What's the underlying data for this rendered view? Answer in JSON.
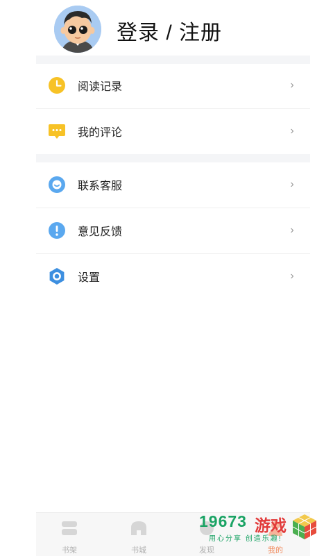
{
  "header": {
    "login_label": "登录 / 注册"
  },
  "menu_group_1": [
    {
      "label": "阅读记录",
      "icon": "clock-icon",
      "color": "#f7c226"
    },
    {
      "label": "我的评论",
      "icon": "comment-icon",
      "color": "#f7c226"
    }
  ],
  "menu_group_2": [
    {
      "label": "联系客服",
      "icon": "customer-service-icon",
      "color": "#5aa8ef"
    },
    {
      "label": "意见反馈",
      "icon": "feedback-icon",
      "color": "#5aa8ef"
    },
    {
      "label": "设置",
      "icon": "settings-icon",
      "color": "#3d8fe0"
    }
  ],
  "tabbar": [
    {
      "label": "书架",
      "icon": "bookshelf-icon"
    },
    {
      "label": "书城",
      "icon": "bookstore-icon"
    },
    {
      "label": "发现",
      "icon": "discover-icon"
    },
    {
      "label": "我的",
      "icon": "profile-icon",
      "active": true
    }
  ],
  "watermark": {
    "number": "19673",
    "name": "游戏",
    "tagline": "用心分享 创造乐趣!"
  },
  "colors": {
    "accent": "#f08a5d",
    "separator": "#f4f5f7"
  }
}
